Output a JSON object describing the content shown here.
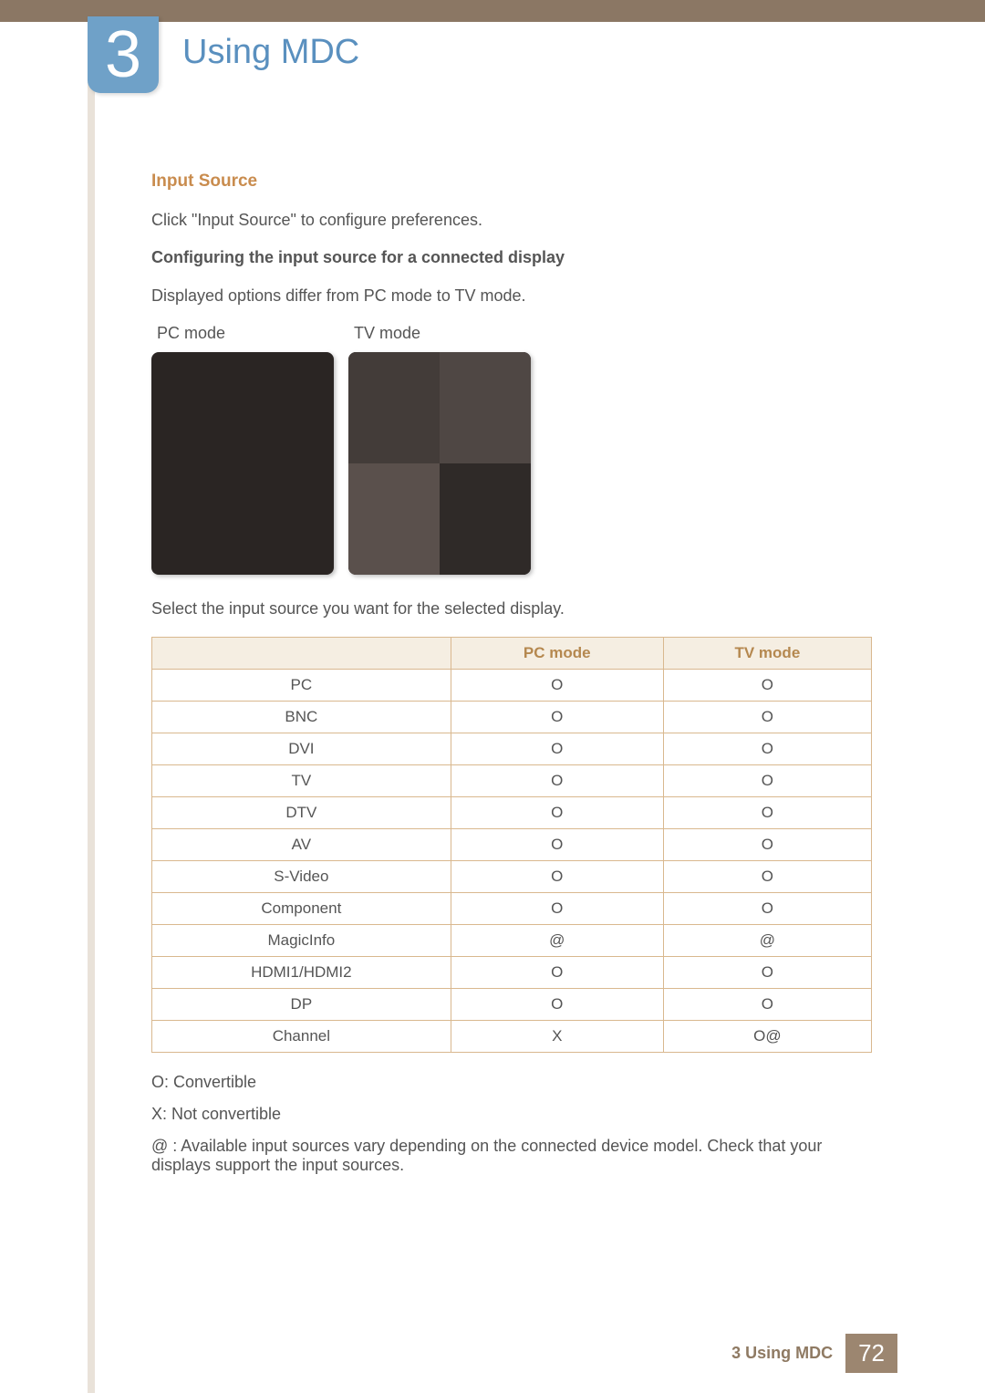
{
  "chapter": {
    "number": "3",
    "title": "Using MDC"
  },
  "section": {
    "heading": "Input Source",
    "p1": "Click \"Input Source\" to configure preferences.",
    "sub1": "Configuring the input source for a connected display",
    "p2": "Displayed options differ from PC mode to TV mode.",
    "modes": {
      "pc": "PC mode",
      "tv": "TV mode"
    },
    "p3": "Select the input source you want for the selected display."
  },
  "table": {
    "headers": {
      "blank": "",
      "pc": "PC mode",
      "tv": "TV mode"
    },
    "rows": [
      {
        "name": "PC",
        "pc": "O",
        "tv": "O"
      },
      {
        "name": "BNC",
        "pc": "O",
        "tv": "O"
      },
      {
        "name": "DVI",
        "pc": "O",
        "tv": "O"
      },
      {
        "name": "TV",
        "pc": "O",
        "tv": "O"
      },
      {
        "name": "DTV",
        "pc": "O",
        "tv": "O"
      },
      {
        "name": "AV",
        "pc": "O",
        "tv": "O"
      },
      {
        "name": "S-Video",
        "pc": "O",
        "tv": "O"
      },
      {
        "name": "Component",
        "pc": "O",
        "tv": "O"
      },
      {
        "name": "MagicInfo",
        "pc": "@",
        "tv": "@"
      },
      {
        "name": "HDMI1/HDMI2",
        "pc": "O",
        "tv": "O"
      },
      {
        "name": "DP",
        "pc": "O",
        "tv": "O"
      },
      {
        "name": "Channel",
        "pc": "X",
        "tv": "O@"
      }
    ]
  },
  "legend": {
    "o": "O: Convertible",
    "x": "X: Not convertible",
    "at": "@ : Available input sources vary depending on the connected device model. Check that your displays support the input sources."
  },
  "footer": {
    "label": "3 Using MDC",
    "page": "72"
  }
}
